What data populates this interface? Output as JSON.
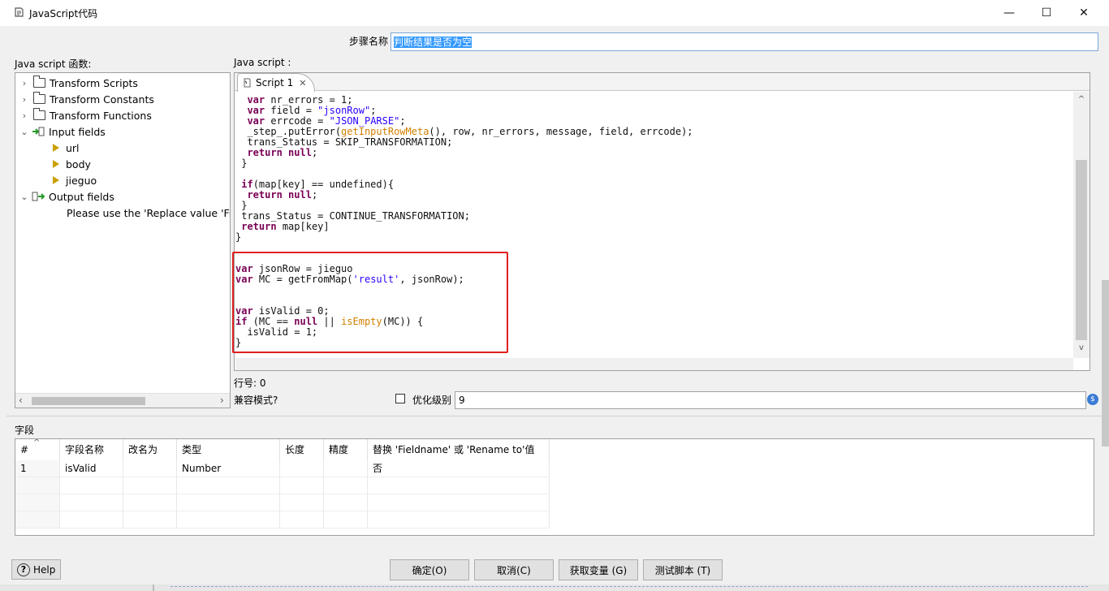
{
  "window": {
    "title": "JavaScript代码",
    "minimize": "—",
    "maximize": "☐",
    "close": "✕"
  },
  "step": {
    "label": "步骤名称",
    "value": "判断结果是否为空"
  },
  "functions_panel": {
    "label": "Java script 函数:",
    "tree": [
      {
        "label": "Transform Scripts",
        "chevron": "›"
      },
      {
        "label": "Transform Constants",
        "chevron": "›"
      },
      {
        "label": "Transform Functions",
        "chevron": "›"
      },
      {
        "label": "Input fields",
        "chevron": "⌄"
      },
      {
        "label": "url"
      },
      {
        "label": "body"
      },
      {
        "label": "jieguo"
      },
      {
        "label": "Output fields",
        "chevron": "⌄"
      },
      {
        "label": "Please use the 'Replace value 'Fieldname' or 'Rename to'' column"
      }
    ],
    "scroll_left": "‹",
    "scroll_right": "›"
  },
  "script_panel": {
    "label": "Java script :",
    "tab_label": "Script 1",
    "tab_close": "✕",
    "scroll_up": "^",
    "scroll_down": "v"
  },
  "editor": {
    "line_number_label": "行号: 0",
    "compat_label": "兼容模式?",
    "opt_label": "优化级别",
    "opt_value": "9",
    "opt_icon": "$"
  },
  "fields": {
    "label": "字段",
    "columns": [
      "#",
      "字段名称",
      "改名为",
      "类型",
      "长度",
      "精度",
      "替换 'Fieldname' 或 'Rename to'值"
    ],
    "sort_indicator": "^",
    "rows": [
      {
        "num": "1",
        "name": "isValid",
        "rename": "",
        "type": "Number",
        "length": "",
        "precision": "",
        "replace": "否"
      }
    ]
  },
  "buttons": {
    "help": "Help",
    "help_icon": "?",
    "ok": "确定(O)",
    "cancel": "取消(C)",
    "get_vars": "获取变量 (G)",
    "test": "测试脚本 (T)"
  }
}
